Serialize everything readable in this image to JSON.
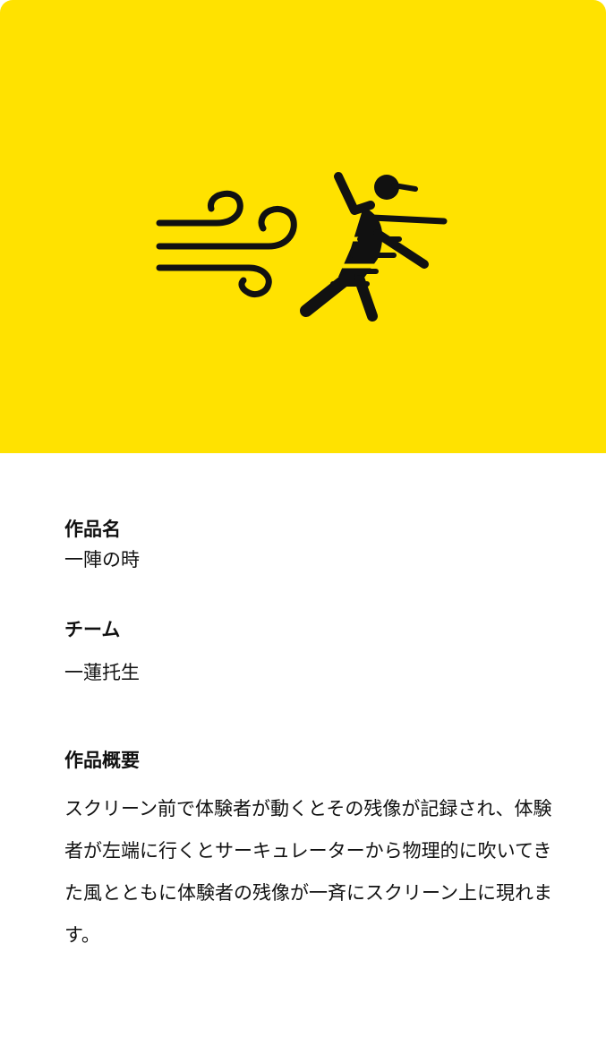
{
  "hero": {
    "background_color": "#FFE200",
    "icon": "wind-person-icon"
  },
  "work": {
    "title_label": "作品名",
    "title_value": "一陣の時",
    "team_label": "チーム",
    "team_value": "一蓮托生",
    "summary_label": "作品概要",
    "summary_text": "スクリーン前で体験者が動くとその残像が記録され、体験者が左端に行くとサーキュレーターから物理的に吹いてきた風とともに体験者の残像が一斉にスクリーン上に現れます。"
  }
}
